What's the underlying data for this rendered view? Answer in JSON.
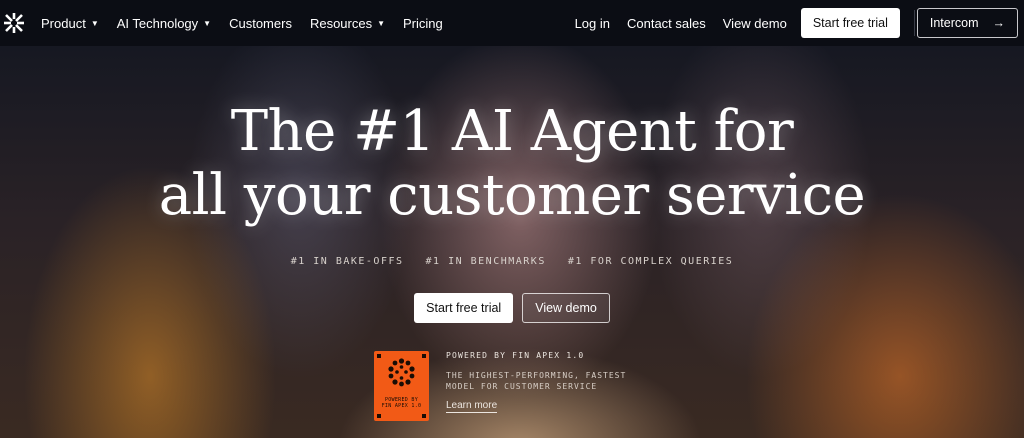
{
  "nav": {
    "logo_icon": "intercom-asterisk-logo",
    "left_items": [
      {
        "label": "Product",
        "has_caret": true
      },
      {
        "label": "AI Technology",
        "has_caret": true
      },
      {
        "label": "Customers",
        "has_caret": false
      },
      {
        "label": "Resources",
        "has_caret": true
      },
      {
        "label": "Pricing",
        "has_caret": false
      }
    ],
    "login_label": "Log in",
    "contact_label": "Contact sales",
    "demo_label": "View demo",
    "trial_label": "Start free trial",
    "intercom_label": "Intercom",
    "intercom_arrow": "→"
  },
  "hero": {
    "headline_line1": "The #1 AI Agent for",
    "headline_line2": "all your customer service",
    "badges": [
      "#1 IN BAKE-OFFS",
      "#1 IN BENCHMARKS",
      "#1 FOR COMPLEX QUERIES"
    ],
    "primary_cta": "Start free trial",
    "secondary_cta": "View demo"
  },
  "apex": {
    "card_line1": "POWERED BY",
    "card_line2": "FIN APEX 1.0",
    "title": "POWERED BY FIN APEX 1.0",
    "description": "THE HIGHEST-PERFORMING, FASTEST MODEL FOR CUSTOMER SERVICE",
    "link_label": "Learn more"
  },
  "colors": {
    "nav_bg": "#0b0d14",
    "apex_orange": "#f25a16",
    "button_white": "#ffffff"
  }
}
